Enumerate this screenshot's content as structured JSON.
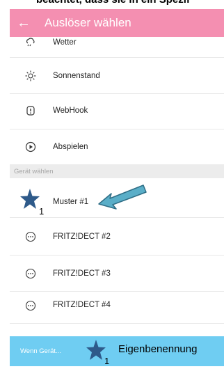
{
  "caption": "beachtet, dass sie in ein Spezif",
  "header": {
    "back_icon": "arrow-left-icon",
    "title": "Auslöser wählen"
  },
  "triggers": [
    {
      "label": "Wetter",
      "icon": "weather-icon"
    },
    {
      "label": "Sonnenstand",
      "icon": "sun-icon"
    },
    {
      "label": "WebHook",
      "icon": "webhook-icon"
    },
    {
      "label": "Abspielen",
      "icon": "play-icon"
    }
  ],
  "device_section": {
    "label": "Gerät wählen"
  },
  "devices": [
    {
      "label": "Muster #1",
      "icon": "device-icon"
    },
    {
      "label": "FRITZ!DECT #2",
      "icon": "device-icon"
    },
    {
      "label": "FRITZ!DECT #3",
      "icon": "device-icon"
    },
    {
      "label": "FRITZ!DECT #4",
      "icon": "device-icon"
    }
  ],
  "footer": {
    "label": "Wenn Gerät...",
    "annotation": "Eigenbenennung"
  },
  "annotations": {
    "star_subscript": "1"
  },
  "colors": {
    "header": "#f48fb1",
    "footer": "#6fcdf2",
    "star": "#2e5a8a",
    "arrow": "#5aaec8"
  }
}
